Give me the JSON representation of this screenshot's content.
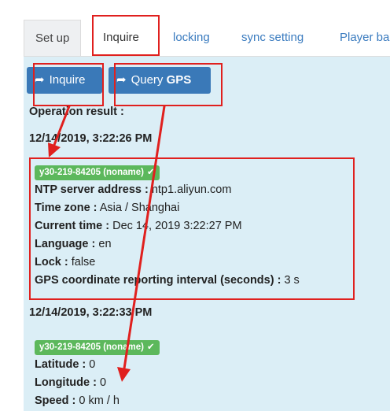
{
  "tabs": [
    {
      "label": "Set up"
    },
    {
      "label": "Inquire"
    },
    {
      "label": "locking"
    },
    {
      "label": "sync setting"
    },
    {
      "label": "Player ba"
    }
  ],
  "buttons": {
    "inquire": "Inquire",
    "query_prefix": "Query",
    "query_bold": "GPS"
  },
  "operation_result_label": "Operation result :",
  "result1": {
    "timestamp": "12/14/2019, 3:22:26 PM",
    "device_badge": "y30-219-84205 (noname)",
    "fields": [
      {
        "label": "NTP server address :",
        "value": "ntp1.aliyun.com"
      },
      {
        "label": "Time zone :",
        "value": "Asia / Shanghai"
      },
      {
        "label": "Current time :",
        "value": "Dec 14, 2019 3:22:27 PM"
      },
      {
        "label": "Language :",
        "value": "en"
      },
      {
        "label": "Lock :",
        "value": "false"
      },
      {
        "label": "GPS coordinate reporting interval (seconds) :",
        "value": "3 s"
      }
    ]
  },
  "result2": {
    "timestamp": "12/14/2019, 3:22:33 PM",
    "device_badge": "y30-219-84205 (noname)",
    "fields": [
      {
        "label": "Latitude :",
        "value": "0"
      },
      {
        "label": "Longitude :",
        "value": "0"
      },
      {
        "label": "Speed :",
        "value": "0 km / h"
      }
    ]
  },
  "colors": {
    "annotation_red": "#e0201e",
    "button_blue": "#3a79b8",
    "badge_green": "#5cb85c",
    "panel_bg": "#dbeef6",
    "link": "#3a7bbf"
  },
  "icons": {
    "button_arrow": "share-arrow-icon",
    "badge_check": "checkmark-icon"
  }
}
